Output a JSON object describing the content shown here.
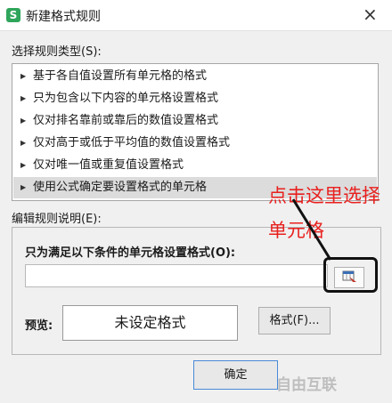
{
  "window": {
    "title": "新建格式规则",
    "icon_name": "wps-spreadsheet-icon",
    "close_glyph": "×"
  },
  "rule_type": {
    "label": "选择规则类型(S):",
    "items": [
      {
        "label": "基于各自值设置所有单元格的格式"
      },
      {
        "label": "只为包含以下内容的单元格设置格式"
      },
      {
        "label": "仅对排名靠前或靠后的数值设置格式"
      },
      {
        "label": "仅对高于或低于平均值的数值设置格式"
      },
      {
        "label": "仅对唯一值或重复值设置格式"
      },
      {
        "label": "使用公式确定要设置格式的单元格",
        "selected": true
      }
    ]
  },
  "rule_description": {
    "label": "编辑规则说明(E):",
    "condition_label": "只为满足以下条件的单元格设置格式(O):",
    "formula_value": "",
    "preview_label": "预览:",
    "preview_text": "未设定格式",
    "format_button": "格式(F)..."
  },
  "footer": {
    "ok_button": "确定"
  },
  "annotation": {
    "line1": "点击这里选择",
    "line2": "单元格"
  },
  "watermark": {
    "text": "自由互联"
  },
  "colors": {
    "annotation": "#e8201e",
    "selected_row": "#dcdcdc",
    "app_icon": "#2fa55b"
  }
}
